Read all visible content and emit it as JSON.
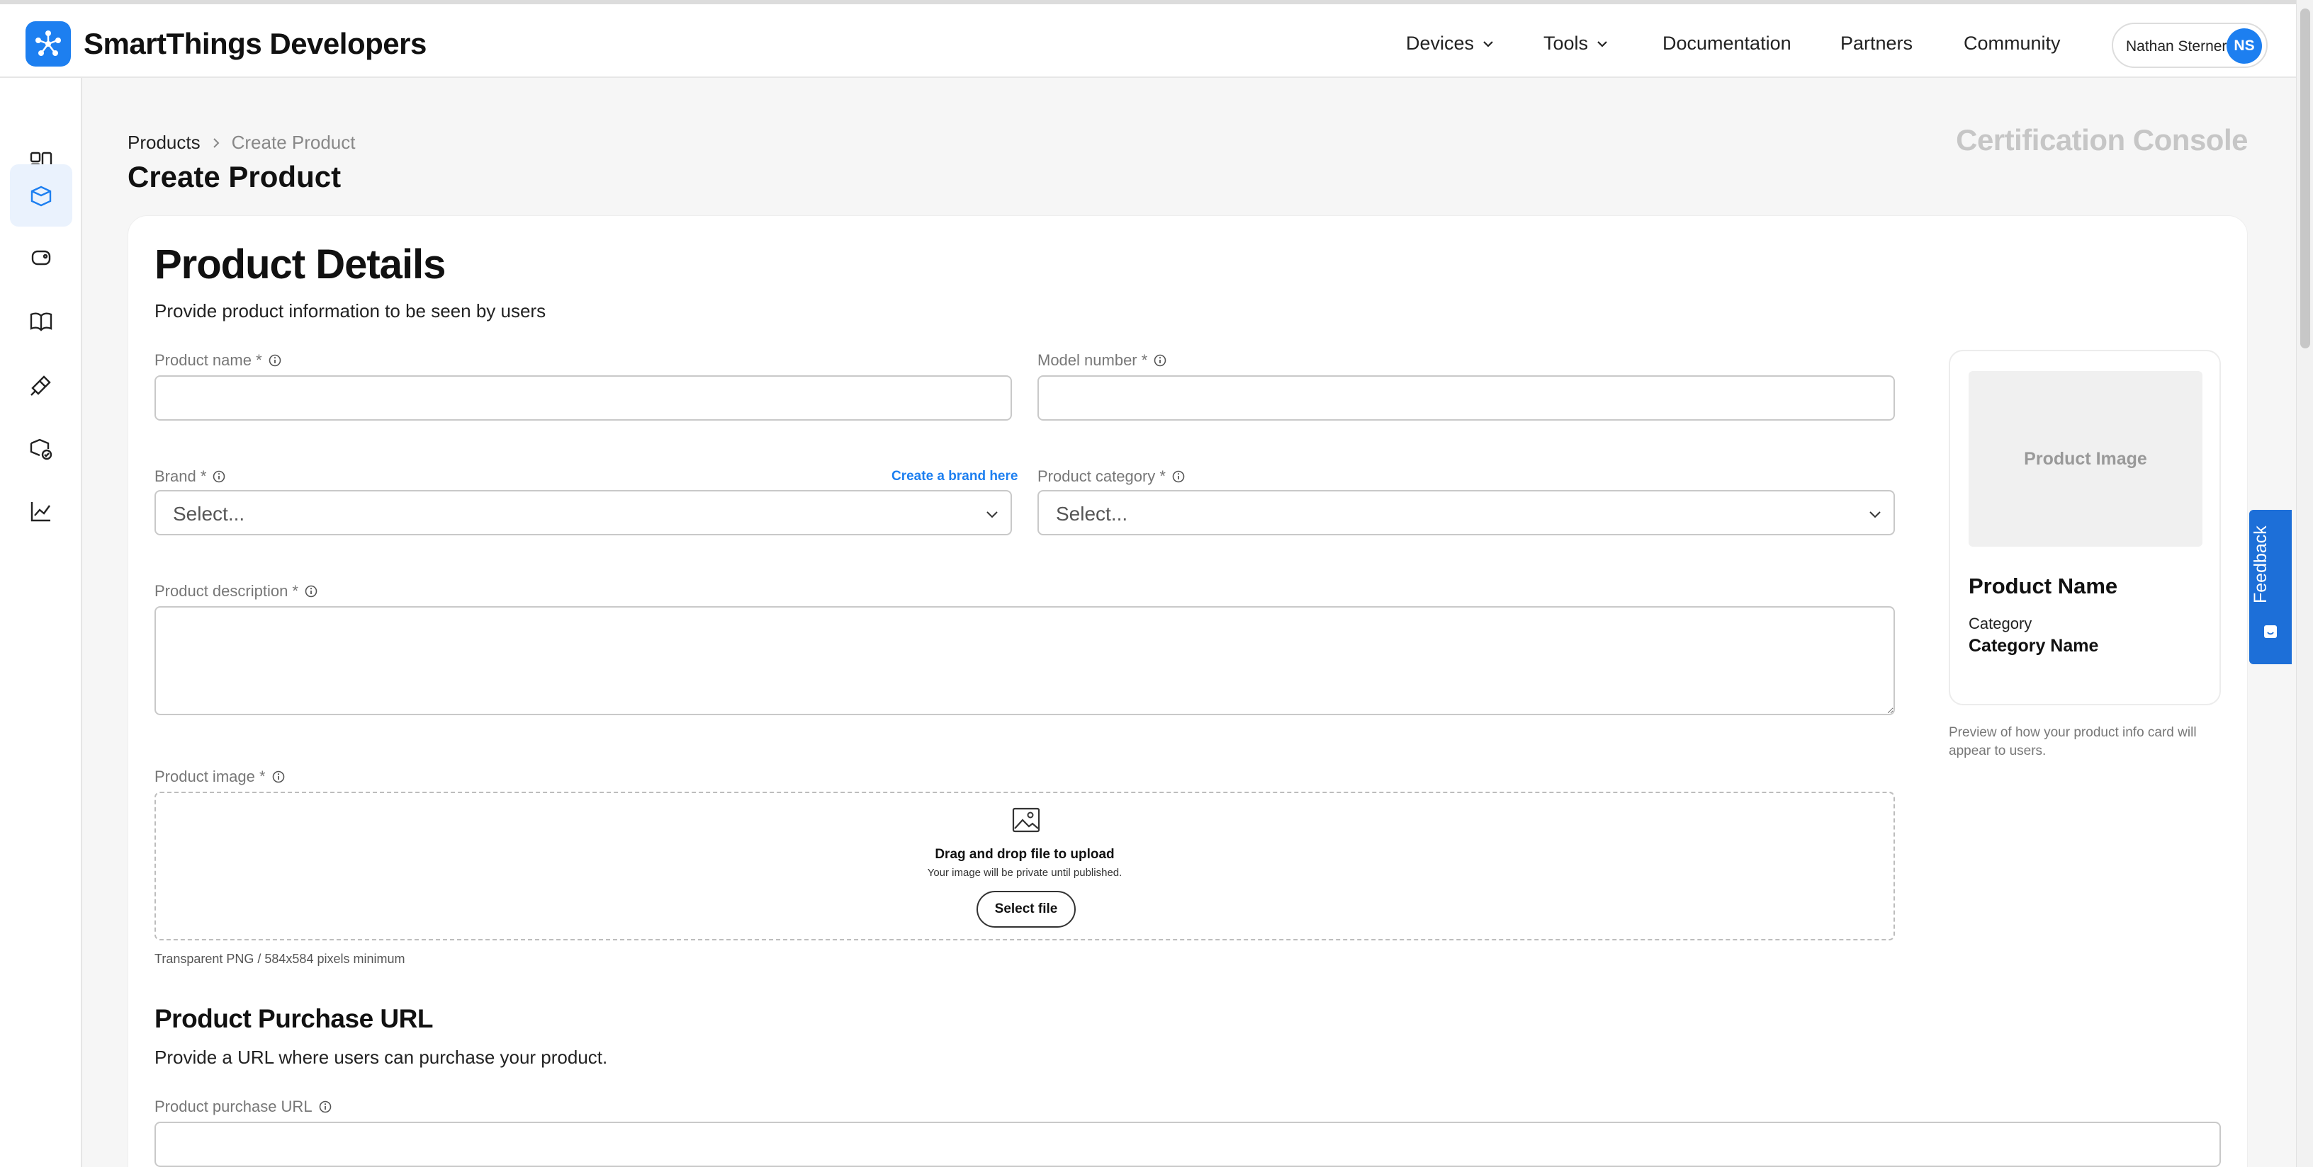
{
  "header": {
    "brand": "SmartThings Developers",
    "nav": [
      {
        "label": "Devices",
        "has_dropdown": true
      },
      {
        "label": "Tools",
        "has_dropdown": true
      },
      {
        "label": "Documentation",
        "has_dropdown": false
      },
      {
        "label": "Partners",
        "has_dropdown": false
      },
      {
        "label": "Community",
        "has_dropdown": false
      }
    ],
    "user": {
      "name": "Nathan Sterner",
      "initials": "NS"
    }
  },
  "sidebar": {
    "items": [
      {
        "icon": "dashboard-icon",
        "active": false
      },
      {
        "icon": "product-box-icon",
        "active": true
      },
      {
        "icon": "device-icon",
        "active": false
      },
      {
        "icon": "book-icon",
        "active": false
      },
      {
        "icon": "tools-icon",
        "active": false
      },
      {
        "icon": "certification-icon",
        "active": false
      },
      {
        "icon": "analytics-icon",
        "active": false
      }
    ]
  },
  "breadcrumb": {
    "parent": "Products",
    "separator": ">",
    "current": "Create Product"
  },
  "page": {
    "title": "Create Product",
    "console_label": "Certification Console"
  },
  "details": {
    "heading": "Product Details",
    "subtitle": "Provide product information to be seen by users",
    "product_name_label": "Product name *",
    "model_number_label": "Model number *",
    "brand_label": "Brand *",
    "brand_placeholder": "Select...",
    "create_brand_link": "Create a brand here",
    "category_label": "Product category *",
    "category_placeholder": "Select...",
    "description_label": "Product description *",
    "image_label": "Product image *",
    "dropzone_title": "Drag and drop file to upload",
    "dropzone_sub": "Your image will be private until published.",
    "select_file": "Select file",
    "image_hint": "Transparent PNG / 584x584 pixels minimum"
  },
  "purchase": {
    "heading": "Product Purchase URL",
    "subtitle": "Provide a URL where users can purchase your product.",
    "url_label": "Product purchase URL"
  },
  "preview": {
    "image_placeholder": "Product Image",
    "name": "Product Name",
    "category_label": "Category",
    "category_value": "Category Name",
    "note": "Preview of how your product info card will appear to users."
  },
  "feedback": {
    "label": "Feedback"
  },
  "colors": {
    "accent": "#1d7ff0",
    "feedback": "#1d6fd8",
    "console_text": "#c6c6c6"
  }
}
